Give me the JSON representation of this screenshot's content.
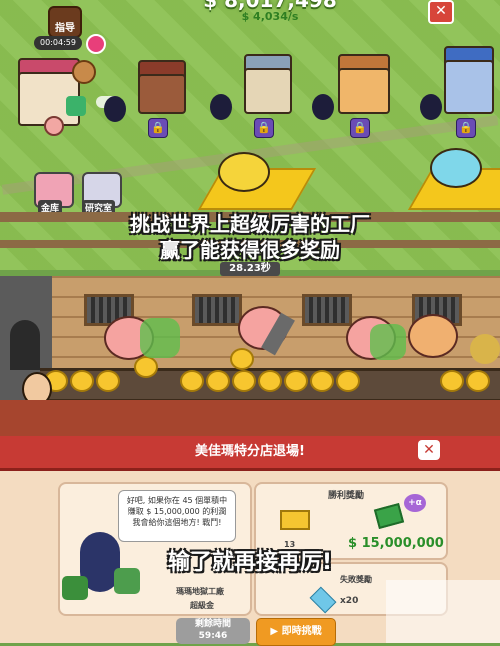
{
  "top": {
    "money": "$ 8,017,498",
    "rate": "$ 4,034/s",
    "guide_button": "指导",
    "timer": "00:04:59",
    "close": "✕",
    "storage_label": "金库",
    "lab_label": "研究室",
    "caption_line1": "挑战世界上超级厉害的工厂",
    "caption_line2": "赢了能获得很多奖励",
    "seconds": "28.23秒"
  },
  "panel": {
    "title": "美佳瑪特分店退場!",
    "close": "✕",
    "speech": "好吧, 如果你在 45 個單積中賺取 $ 15,000,000 的利潤 我會給你這個地方! 戰鬥!",
    "reward_title": "勝利獎勵",
    "reward_amount": "$ 15,000,000",
    "plus_label": "+α",
    "count_13": "13",
    "count_x20": "x20",
    "defeat_reward_label": "失敗獎勵",
    "opponent_name": "瑪瑪地獄工廠",
    "opponent_sub": "超級金",
    "overlay_caption": "输了就再接再厉!",
    "time_button": "剩餘時間",
    "time_value": "59:46",
    "play_button": "即時挑戰"
  },
  "colors": {
    "grass": "#8cc152",
    "title_red": "#c73a34",
    "panel_bg": "#f4dcc1",
    "coin_gold": "#f7c62f",
    "money_green": "#2a8f2a"
  }
}
